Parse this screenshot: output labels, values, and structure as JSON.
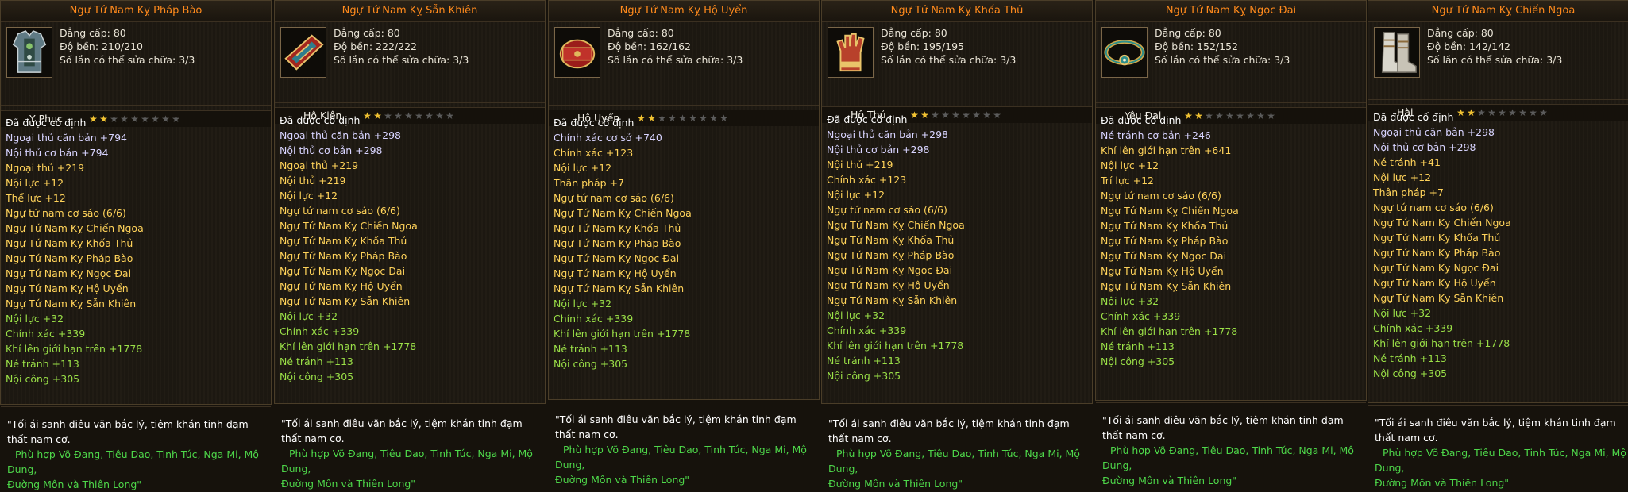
{
  "labels": {
    "level": "Đẳng cấp: 80",
    "fixed": "Đã được cố định",
    "quote": "\"Tối ái sanh điêu văn bắc lý, tiệm khán tinh đạm thất nam cơ.",
    "suit_line1": "Phù hợp Võ Đang, Tiêu Dao, Tinh Túc, Nga Mi, Mộ Dung,",
    "suit_line2": "Đường Môn và Thiên Long\""
  },
  "colors": {
    "title": "#ff8a1c",
    "fixed": "#ffffff",
    "set": "#ffd35a",
    "bonus": "#9adf47",
    "suit": "#4ed84a"
  },
  "items": [
    {
      "name": "Ngự Tứ Nam Kỵ Pháp Bào",
      "durability": "Độ bền: 210/210",
      "repair": "Số lần có thể sửa chữa: 3/3",
      "type": "Y Phục",
      "stars_filled": 2,
      "stars_total": 9,
      "icon": "armor-icon",
      "props": [
        {
          "text": "Đã được cố định",
          "kind": "fixed"
        },
        {
          "text": "Ngoại thủ căn bản +794",
          "kind": "blue"
        },
        {
          "text": "Nội thủ cơ bản +794",
          "kind": "blue"
        },
        {
          "text": "Ngoại thủ +219",
          "kind": "yellow"
        },
        {
          "text": "Nội lực +12",
          "kind": "yellow"
        },
        {
          "text": "Thể lực +12",
          "kind": "yellow"
        },
        {
          "text": "Ngự tứ nam cơ sáo (6/6)",
          "kind": "yellow"
        },
        {
          "text": "Ngự Tứ Nam Kỵ Chiến Ngoa",
          "kind": "yellow"
        },
        {
          "text": "Ngự Tứ Nam Kỵ Khốa Thủ",
          "kind": "yellow"
        },
        {
          "text": "Ngự Tứ Nam Kỵ Pháp Bào",
          "kind": "yellow"
        },
        {
          "text": "Ngự Tứ Nam Kỵ Ngọc Đai",
          "kind": "yellow"
        },
        {
          "text": "Ngự Tứ Nam Kỵ Hộ Uyển",
          "kind": "yellow"
        },
        {
          "text": "Ngự Tứ Nam Kỵ Sẫn Khiên",
          "kind": "yellow"
        },
        {
          "text": "Nội lực +32",
          "kind": "green"
        },
        {
          "text": "Chính xác +339",
          "kind": "green"
        },
        {
          "text": "Khí lên giới hạn trên +1778",
          "kind": "green"
        },
        {
          "text": "Né tránh +113",
          "kind": "green"
        },
        {
          "text": "Nội công +305",
          "kind": "green"
        }
      ]
    },
    {
      "name": "Ngự Tứ Nam Kỵ Sẫn Khiên",
      "durability": "Độ bền: 222/222",
      "repair": "Số lần có thể sửa chữa: 3/3",
      "type": "Hộ Kiên",
      "stars_filled": 2,
      "stars_total": 9,
      "icon": "shoulder-guard-icon",
      "props": [
        {
          "text": "Đã được cố định",
          "kind": "fixed"
        },
        {
          "text": "Ngoại thủ căn bản +298",
          "kind": "blue"
        },
        {
          "text": "Nội thủ cơ bản +298",
          "kind": "blue"
        },
        {
          "text": "Ngoại thủ +219",
          "kind": "yellow"
        },
        {
          "text": "Nội thủ +219",
          "kind": "yellow"
        },
        {
          "text": "Nội lực +12",
          "kind": "yellow"
        },
        {
          "text": "Ngự tứ nam cơ sáo (6/6)",
          "kind": "yellow"
        },
        {
          "text": "Ngự Tứ Nam Kỵ Chiến Ngoa",
          "kind": "yellow"
        },
        {
          "text": "Ngự Tứ Nam Kỵ Khốa Thủ",
          "kind": "yellow"
        },
        {
          "text": "Ngự Tứ Nam Kỵ Pháp Bào",
          "kind": "yellow"
        },
        {
          "text": "Ngự Tứ Nam Kỵ Ngọc Đai",
          "kind": "yellow"
        },
        {
          "text": "Ngự Tứ Nam Kỵ Hộ Uyển",
          "kind": "yellow"
        },
        {
          "text": "Ngự Tứ Nam Kỵ Sẫn Khiên",
          "kind": "yellow"
        },
        {
          "text": "Nội lực +32",
          "kind": "green"
        },
        {
          "text": "Chính xác +339",
          "kind": "green"
        },
        {
          "text": "Khí lên giới hạn trên +1778",
          "kind": "green"
        },
        {
          "text": "Né tránh +113",
          "kind": "green"
        },
        {
          "text": "Nội công +305",
          "kind": "green"
        }
      ]
    },
    {
      "name": "Ngự Tứ Nam Kỵ Hộ Uyển",
      "durability": "Độ bền: 162/162",
      "repair": "Số lần có thể sửa chữa: 3/3",
      "type": "Hộ Uyển",
      "stars_filled": 2,
      "stars_total": 9,
      "icon": "bracer-icon",
      "props": [
        {
          "text": "Đã được cố định",
          "kind": "fixed"
        },
        {
          "text": "Chính xác cơ sở +740",
          "kind": "blue"
        },
        {
          "text": "Chính xác +123",
          "kind": "yellow"
        },
        {
          "text": "Nội lực +12",
          "kind": "yellow"
        },
        {
          "text": "Thân pháp +7",
          "kind": "yellow"
        },
        {
          "text": "Ngự tứ nam cơ sáo (6/6)",
          "kind": "yellow"
        },
        {
          "text": "Ngự Tứ Nam Kỵ Chiến Ngoa",
          "kind": "yellow"
        },
        {
          "text": "Ngự Tứ Nam Kỵ Khốa Thủ",
          "kind": "yellow"
        },
        {
          "text": "Ngự Tứ Nam Kỵ Pháp Bào",
          "kind": "yellow"
        },
        {
          "text": "Ngự Tứ Nam Kỵ Ngọc Đai",
          "kind": "yellow"
        },
        {
          "text": "Ngự Tứ Nam Kỵ Hộ Uyển",
          "kind": "yellow"
        },
        {
          "text": "Ngự Tứ Nam Kỵ Sẫn Khiên",
          "kind": "yellow"
        },
        {
          "text": "Nội lực +32",
          "kind": "green"
        },
        {
          "text": "Chính xác +339",
          "kind": "green"
        },
        {
          "text": "Khí lên giới hạn trên +1778",
          "kind": "green"
        },
        {
          "text": "Né tránh +113",
          "kind": "green"
        },
        {
          "text": "Nội công +305",
          "kind": "green"
        }
      ]
    },
    {
      "name": "Ngự Tứ Nam Kỵ Khốa Thủ",
      "durability": "Độ bền: 195/195",
      "repair": "Số lần có thể sửa chữa: 3/3",
      "type": "Hộ Thủ",
      "stars_filled": 2,
      "stars_total": 9,
      "icon": "glove-icon",
      "props": [
        {
          "text": "Đã được cố định",
          "kind": "fixed"
        },
        {
          "text": "Ngoại thủ căn bản +298",
          "kind": "blue"
        },
        {
          "text": "Nội thủ cơ bản +298",
          "kind": "blue"
        },
        {
          "text": "Nội thủ +219",
          "kind": "yellow"
        },
        {
          "text": "Chính xác +123",
          "kind": "yellow"
        },
        {
          "text": "Nội lực +12",
          "kind": "yellow"
        },
        {
          "text": "Ngự tứ nam cơ sáo (6/6)",
          "kind": "yellow"
        },
        {
          "text": "Ngự Tứ Nam Kỵ Chiến Ngoa",
          "kind": "yellow"
        },
        {
          "text": "Ngự Tứ Nam Kỵ Khốa Thủ",
          "kind": "yellow"
        },
        {
          "text": "Ngự Tứ Nam Kỵ Pháp Bào",
          "kind": "yellow"
        },
        {
          "text": "Ngự Tứ Nam Kỵ Ngọc Đai",
          "kind": "yellow"
        },
        {
          "text": "Ngự Tứ Nam Kỵ Hộ Uyển",
          "kind": "yellow"
        },
        {
          "text": "Ngự Tứ Nam Kỵ Sẫn Khiên",
          "kind": "yellow"
        },
        {
          "text": "Nội lực +32",
          "kind": "green"
        },
        {
          "text": "Chính xác +339",
          "kind": "green"
        },
        {
          "text": "Khí lên giới hạn trên +1778",
          "kind": "green"
        },
        {
          "text": "Né tránh +113",
          "kind": "green"
        },
        {
          "text": "Nội công +305",
          "kind": "green"
        }
      ]
    },
    {
      "name": "Ngự Tứ Nam Kỵ Ngọc Đai",
      "durability": "Độ bền: 152/152",
      "repair": "Số lần có thể sửa chữa: 3/3",
      "type": "Yêu Đai",
      "stars_filled": 2,
      "stars_total": 9,
      "icon": "belt-icon",
      "props": [
        {
          "text": "Đã được cố định",
          "kind": "fixed"
        },
        {
          "text": "Né tránh cơ bản +246",
          "kind": "blue"
        },
        {
          "text": "Khí lên giới hạn trên +641",
          "kind": "yellow"
        },
        {
          "text": "Nội lực +12",
          "kind": "yellow"
        },
        {
          "text": "Trí lực +12",
          "kind": "yellow"
        },
        {
          "text": "Ngự tứ nam cơ sáo (6/6)",
          "kind": "yellow"
        },
        {
          "text": "Ngự Tứ Nam Kỵ Chiến Ngoa",
          "kind": "yellow"
        },
        {
          "text": "Ngự Tứ Nam Kỵ Khốa Thủ",
          "kind": "yellow"
        },
        {
          "text": "Ngự Tứ Nam Kỵ Pháp Bào",
          "kind": "yellow"
        },
        {
          "text": "Ngự Tứ Nam Kỵ Ngọc Đai",
          "kind": "yellow"
        },
        {
          "text": "Ngự Tứ Nam Kỵ Hộ Uyển",
          "kind": "yellow"
        },
        {
          "text": "Ngự Tứ Nam Kỵ Sẫn Khiên",
          "kind": "yellow"
        },
        {
          "text": "Nội lực +32",
          "kind": "green"
        },
        {
          "text": "Chính xác +339",
          "kind": "green"
        },
        {
          "text": "Khí lên giới hạn trên +1778",
          "kind": "green"
        },
        {
          "text": "Né tránh +113",
          "kind": "green"
        },
        {
          "text": "Nội công +305",
          "kind": "green"
        }
      ]
    },
    {
      "name": "Ngự Tứ Nam Kỵ Chiến Ngoa",
      "durability": "Độ bền: 142/142",
      "repair": "Số lần có thể sửa chữa: 3/3",
      "type": "Hài",
      "stars_filled": 2,
      "stars_total": 9,
      "icon": "boots-icon",
      "props": [
        {
          "text": "Đã được cố định",
          "kind": "fixed"
        },
        {
          "text": "Ngoại thủ căn bản +298",
          "kind": "blue"
        },
        {
          "text": "Nội thủ cơ bản +298",
          "kind": "blue"
        },
        {
          "text": "Né tránh +41",
          "kind": "yellow"
        },
        {
          "text": "Nội lực +12",
          "kind": "yellow"
        },
        {
          "text": "Thân pháp +7",
          "kind": "yellow"
        },
        {
          "text": "Ngự tứ nam cơ sáo (6/6)",
          "kind": "yellow"
        },
        {
          "text": "Ngự Tứ Nam Kỵ Chiến Ngoa",
          "kind": "yellow"
        },
        {
          "text": "Ngự Tứ Nam Kỵ Khốa Thủ",
          "kind": "yellow"
        },
        {
          "text": "Ngự Tứ Nam Kỵ Pháp Bào",
          "kind": "yellow"
        },
        {
          "text": "Ngự Tứ Nam Kỵ Ngọc Đai",
          "kind": "yellow"
        },
        {
          "text": "Ngự Tứ Nam Kỵ Hộ Uyển",
          "kind": "yellow"
        },
        {
          "text": "Ngự Tứ Nam Kỵ Sẫn Khiên",
          "kind": "yellow"
        },
        {
          "text": "Nội lực +32",
          "kind": "green"
        },
        {
          "text": "Chính xác +339",
          "kind": "green"
        },
        {
          "text": "Khí lên giới hạn trên +1778",
          "kind": "green"
        },
        {
          "text": "Né tránh +113",
          "kind": "green"
        },
        {
          "text": "Nội công +305",
          "kind": "green"
        }
      ]
    }
  ]
}
